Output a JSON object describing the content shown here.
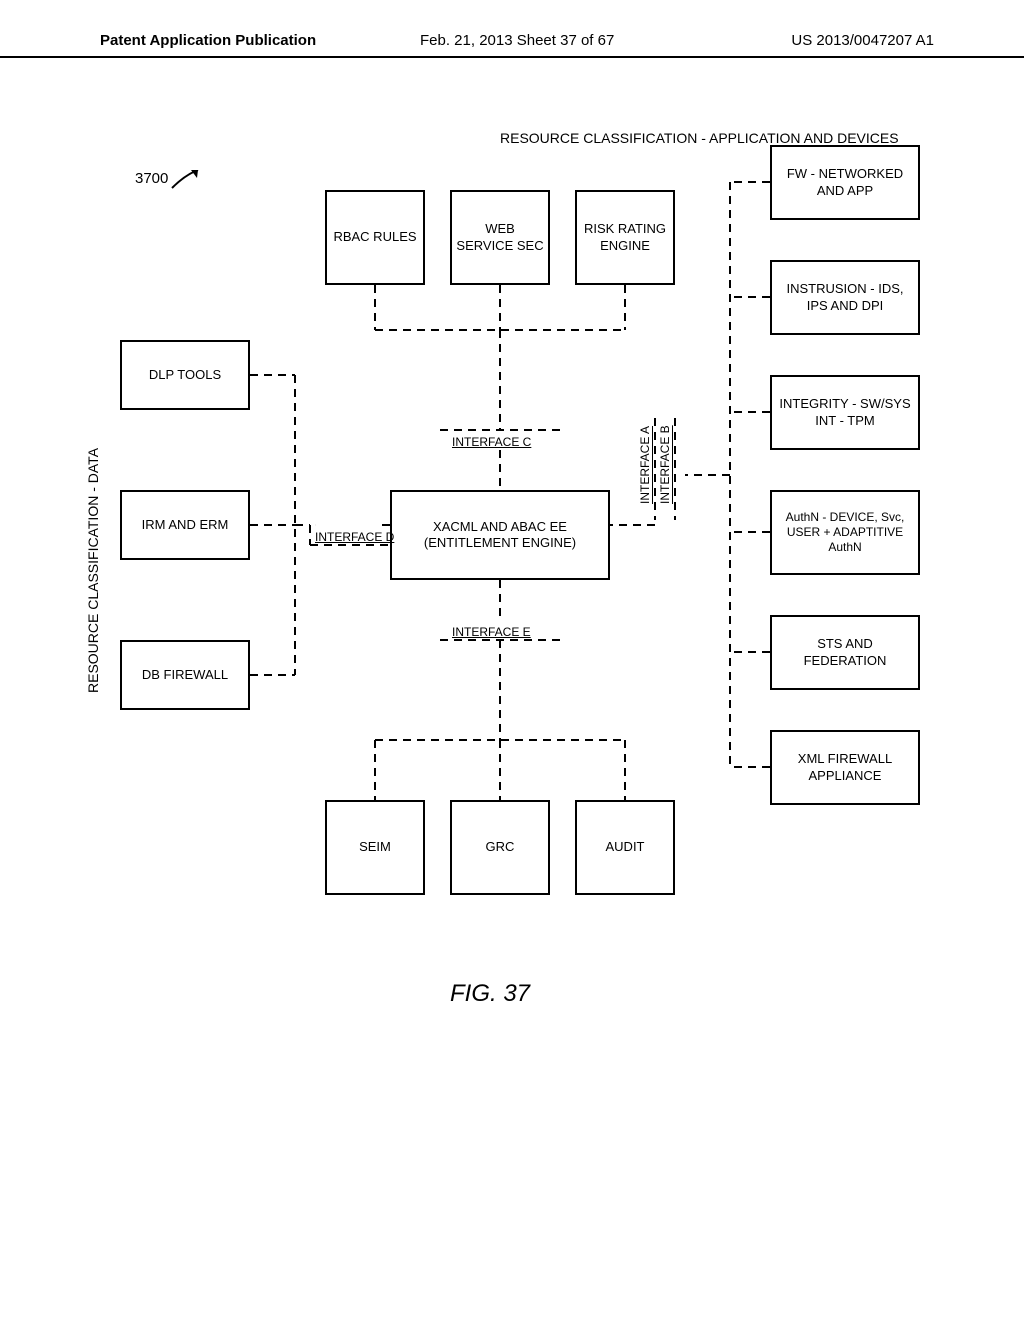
{
  "header": {
    "left": "Patent Application Publication",
    "mid": "Feb. 21, 2013   Sheet 37 of 67",
    "right": "US 2013/0047207 A1"
  },
  "refnum": "3700",
  "figure_label": "FIG. 37",
  "labels": {
    "resource_class_app": "RESOURCE CLASSIFICATION - APPLICATION AND DEVICES",
    "resource_class_data": "RESOURCE CLASSIFICATION - DATA",
    "interface_a": "INTERFACE A",
    "interface_b": "INTERFACE B",
    "interface_c": "INTERFACE C",
    "interface_d": "INTERFACE D",
    "interface_e": "INTERFACE E"
  },
  "left_col": {
    "dlp": "DLP TOOLS",
    "irm": "IRM AND ERM",
    "dbfw": "DB FIREWALL"
  },
  "top_row": {
    "rbac": "RBAC RULES",
    "websvc": "WEB SERVICE SEC",
    "risk": "RISK RATING ENGINE"
  },
  "center": {
    "xacml": "XACML AND ABAC EE (ENTITLEMENT ENGINE)"
  },
  "bottom_row": {
    "seim": "SEIM",
    "grc": "GRC",
    "audit": "AUDIT"
  },
  "right_col": {
    "fw": "FW - NETWORKED AND APP",
    "intrusion": "INSTRUSION - IDS, IPS AND DPI",
    "integrity": "INTEGRITY - SW/SYS INT - TPM",
    "authn": "AuthN - DEVICE, Svc, USER + ADAPTITIVE AuthN",
    "sts": "STS AND FEDERATION",
    "xmlfw": "XML FIREWALL APPLIANCE"
  }
}
